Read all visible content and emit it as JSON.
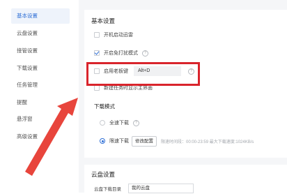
{
  "sidebar": {
    "items": [
      {
        "label": "基本设置",
        "active": true
      },
      {
        "label": "云盘设置"
      },
      {
        "label": "接管设置"
      },
      {
        "label": "下载设置"
      },
      {
        "label": "任务管理"
      },
      {
        "label": "提醒"
      },
      {
        "label": "悬浮窗"
      },
      {
        "label": "高级设置"
      }
    ]
  },
  "basic": {
    "title": "基本设置",
    "autostart_label": "开机启动迅雷",
    "dnd_label": "开启免打扰模式",
    "boss_key_label": "启用老板键",
    "boss_key_value": "Alt+D",
    "newtask_label": "新建任务时显示主界面"
  },
  "download_mode": {
    "title": "下载模式",
    "full_speed_label": "全速下载",
    "limited_label": "限速下载",
    "modify_button": "修改配置",
    "limit_info": "限速时间段：00:00-23:59  最大下载速度:1024KB/s"
  },
  "cloud": {
    "title": "云盘设置",
    "dir_label": "云盘下载目录",
    "dir_value": "我的云盘"
  },
  "colors": {
    "accent": "#2f6fd6",
    "highlight": "#d9242c",
    "arrow": "#e8453c"
  }
}
